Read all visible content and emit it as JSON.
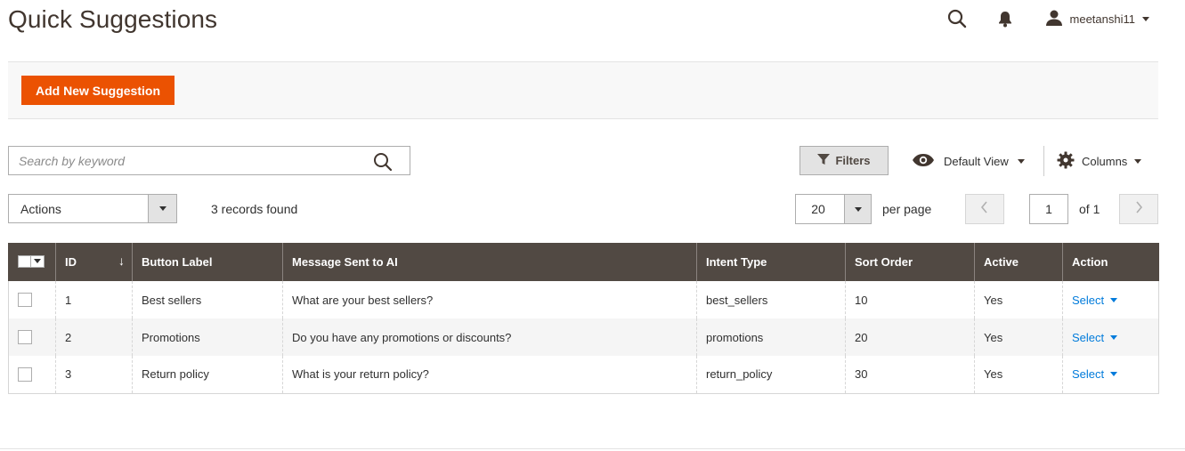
{
  "header": {
    "title": "Quick Suggestions",
    "user_name": "meetanshi11",
    "icons": [
      "search-icon",
      "bell-icon",
      "user-icon"
    ]
  },
  "action_bar": {
    "add_button": "Add New Suggestion"
  },
  "toolbar": {
    "search_placeholder": "Search by keyword",
    "filters_label": "Filters",
    "view_label": "Default View",
    "columns_label": "Columns"
  },
  "listing": {
    "actions_label": "Actions",
    "records_text": "3 records found",
    "per_page_value": "20",
    "per_page_label": "per page",
    "current_page": "1",
    "of_text": "of 1"
  },
  "table": {
    "columns": [
      "ID",
      "Button Label",
      "Message Sent to AI",
      "Intent Type",
      "Sort Order",
      "Active",
      "Action"
    ],
    "rows": [
      {
        "id": "1",
        "label": "Best sellers",
        "message": "What are your best sellers?",
        "intent": "best_sellers",
        "sort": "10",
        "active": "Yes",
        "action": "Select"
      },
      {
        "id": "2",
        "label": "Promotions",
        "message": "Do you have any promotions or discounts?",
        "intent": "promotions",
        "sort": "20",
        "active": "Yes",
        "action": "Select"
      },
      {
        "id": "3",
        "label": "Return policy",
        "message": "What is your return policy?",
        "intent": "return_policy",
        "sort": "30",
        "active": "Yes",
        "action": "Select"
      }
    ]
  },
  "colors": {
    "primary": "#eb5202",
    "header_bg": "#514943",
    "link": "#007bdb",
    "title": "#41362f"
  }
}
